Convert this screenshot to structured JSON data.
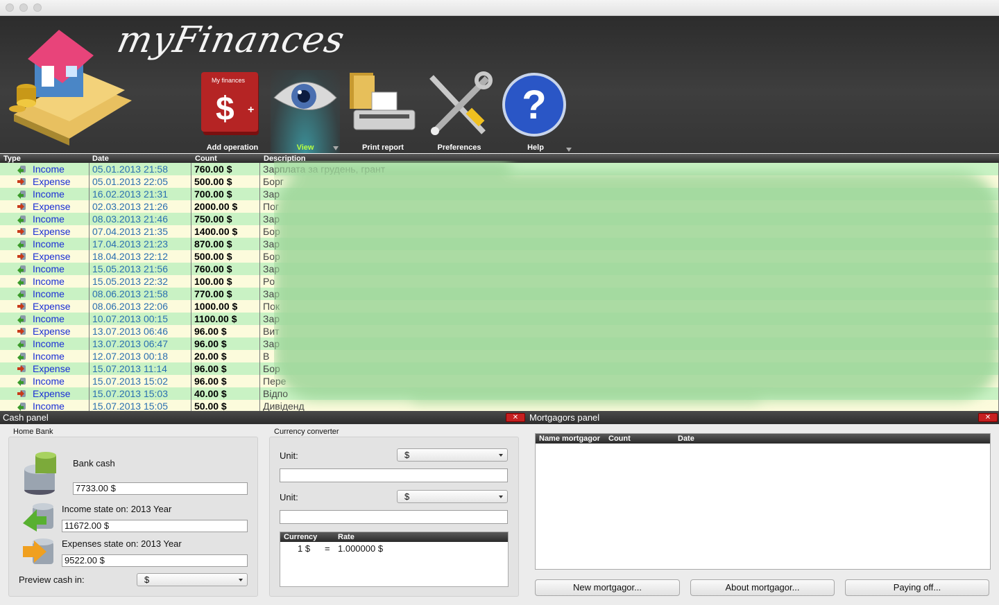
{
  "app": {
    "title": "myFinances"
  },
  "toolbar": {
    "add_operation": "Add operation",
    "view": "View",
    "print_report": "Print report",
    "preferences": "Preferences",
    "help": "Help",
    "book_label": "My finances"
  },
  "table": {
    "headers": {
      "type": "Type",
      "date": "Date",
      "count": "Count",
      "description": "Description"
    },
    "rows": [
      {
        "type": "Income",
        "date": "05.01.2013 21:58",
        "count": "760.00 $",
        "desc": "Зарплата за грудень, грант"
      },
      {
        "type": "Expense",
        "date": "05.01.2013 22:05",
        "count": "500.00 $",
        "desc": "Борг"
      },
      {
        "type": "Income",
        "date": "16.02.2013 21:31",
        "count": "700.00 $",
        "desc": "Зар"
      },
      {
        "type": "Expense",
        "date": "02.03.2013 21:26",
        "count": "2000.00 $",
        "desc": "Пог"
      },
      {
        "type": "Income",
        "date": "08.03.2013 21:46",
        "count": "750.00 $",
        "desc": "Зар"
      },
      {
        "type": "Expense",
        "date": "07.04.2013 21:35",
        "count": "1400.00 $",
        "desc": "Бор"
      },
      {
        "type": "Income",
        "date": "17.04.2013 21:23",
        "count": "870.00 $",
        "desc": "Зар"
      },
      {
        "type": "Expense",
        "date": "18.04.2013 22:12",
        "count": "500.00 $",
        "desc": "Бор"
      },
      {
        "type": "Income",
        "date": "15.05.2013 21:56",
        "count": "760.00 $",
        "desc": "Зар"
      },
      {
        "type": "Income",
        "date": "15.05.2013 22:32",
        "count": "100.00 $",
        "desc": "Po"
      },
      {
        "type": "Income",
        "date": "08.06.2013 21:58",
        "count": "770.00 $",
        "desc": "Зар"
      },
      {
        "type": "Expense",
        "date": "08.06.2013 22:06",
        "count": "1000.00 $",
        "desc": "Пок"
      },
      {
        "type": "Income",
        "date": "10.07.2013 00:15",
        "count": "1100.00 $",
        "desc": "Зар"
      },
      {
        "type": "Expense",
        "date": "13.07.2013 06:46",
        "count": "96.00 $",
        "desc": "Вит"
      },
      {
        "type": "Income",
        "date": "13.07.2013 06:47",
        "count": "96.00 $",
        "desc": "Зар"
      },
      {
        "type": "Income",
        "date": "12.07.2013 00:18",
        "count": "20.00 $",
        "desc": "В"
      },
      {
        "type": "Expense",
        "date": "15.07.2013 11:14",
        "count": "96.00 $",
        "desc": "Бор"
      },
      {
        "type": "Income",
        "date": "15.07.2013 15:02",
        "count": "96.00 $",
        "desc": "Пере"
      },
      {
        "type": "Expense",
        "date": "15.07.2013 15:03",
        "count": "40.00 $",
        "desc": "Відпо"
      },
      {
        "type": "Income",
        "date": "15.07.2013 15:05",
        "count": "50.00 $",
        "desc": "Дивіденд"
      }
    ]
  },
  "cash_panel": {
    "title": "Cash panel",
    "home_bank": "Home Bank",
    "bank_cash_label": "Bank cash",
    "bank_cash_value": "7733.00 $",
    "income_label": "Income state on: 2013 Year",
    "income_value": "11672.00 $",
    "expenses_label": "Expenses state on: 2013 Year",
    "expenses_value": "9522.00 $",
    "preview_label": "Preview cash in:",
    "preview_value": "$"
  },
  "converter": {
    "title": "Currency converter",
    "unit1_label": "Unit:",
    "unit1_value": "$",
    "unit2_label": "Unit:",
    "unit2_value": "$",
    "headers": {
      "currency": "Currency",
      "rate": "Rate"
    },
    "row": {
      "currency": "1 $",
      "eq": "=",
      "rate": "1.000000 $"
    }
  },
  "mortgagors": {
    "title": "Mortgagors panel",
    "headers": {
      "name": "Name mortgagor",
      "count": "Count",
      "date": "Date"
    },
    "new_button": "New mortgagor...",
    "about_button": "About  mortgagor...",
    "paying_button": "Paying off..."
  },
  "colors": {
    "income_row": "#c9f2c4",
    "expense_row": "#fcfbdc",
    "link": "#1a2ed6",
    "close": "#c62020"
  }
}
